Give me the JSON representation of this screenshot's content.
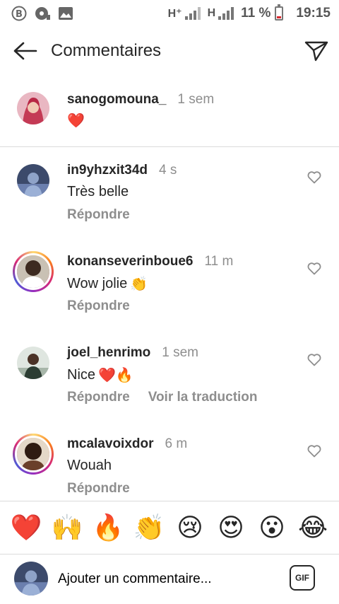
{
  "status_bar": {
    "network_1": "H⁺",
    "network_2": "H",
    "battery": "11 %",
    "time": "19:15"
  },
  "header": {
    "title": "Commentaires"
  },
  "caption": {
    "username": "sanogomouna_",
    "time": "1 sem",
    "text": "❤️"
  },
  "comments": [
    {
      "username": "in9yhzxit34d",
      "time": "4 s",
      "text": "Très belle",
      "emoji": "",
      "actions": [
        "Répondre"
      ]
    },
    {
      "username": "konanseverinboue6",
      "time": "11 m",
      "text": "Wow jolie",
      "emoji": "👏",
      "actions": [
        "Répondre"
      ]
    },
    {
      "username": "joel_henrimo",
      "time": "1 sem",
      "text": "Nice",
      "emoji": "❤️🔥",
      "actions": [
        "Répondre",
        "Voir la traduction"
      ]
    },
    {
      "username": "mcalavoixdor",
      "time": "6 m",
      "text": "Wouah",
      "emoji": "",
      "actions": [
        "Répondre"
      ]
    }
  ],
  "emoji_bar": [
    "❤️",
    "🙌",
    "🔥",
    "👏",
    "😢",
    "😍",
    "😮",
    "😂"
  ],
  "composer": {
    "placeholder": "Ajouter un commentaire...",
    "gif_label": "GIF"
  }
}
